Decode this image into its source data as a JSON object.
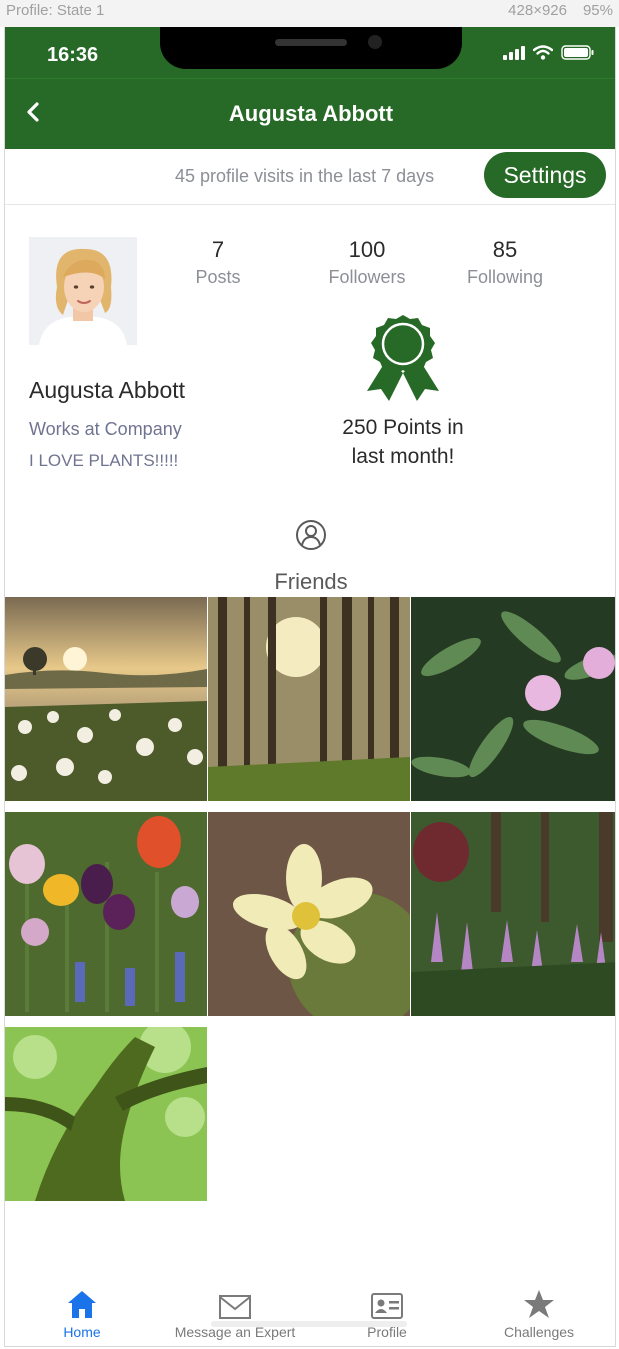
{
  "viewer": {
    "title": "Profile: State 1",
    "dims": "428×926",
    "zoom": "95%"
  },
  "status_bar": {
    "time": "16:36"
  },
  "header": {
    "title": "Augusta Abbott",
    "back_icon": "chevron-left-icon"
  },
  "subbar": {
    "visits": "45 profile visits in the last 7 days",
    "settings_label": "Settings"
  },
  "profile": {
    "name": "Augusta Abbott",
    "work": "Works at Company",
    "bio": "I LOVE PLANTS!!!!!"
  },
  "stats": [
    {
      "value": "7",
      "label": "Posts"
    },
    {
      "value": "100",
      "label": "Followers"
    },
    {
      "value": "85",
      "label": "Following"
    }
  ],
  "award": {
    "icon": "award-ribbon-icon",
    "line1": "250 Points in",
    "line2": "last month!"
  },
  "friends": {
    "label": "Friends",
    "icon": "user-circle-icon"
  },
  "photos": [
    "dandelion-field",
    "sunlit-forest",
    "mimosa-flowers",
    "tulip-garden",
    "lotus-flower",
    "astilbe-garden",
    "mossy-tree"
  ],
  "tabs": [
    {
      "label": "Home",
      "icon": "home-icon",
      "active": true
    },
    {
      "label": "Message an Expert",
      "icon": "mail-icon",
      "active": false
    },
    {
      "label": "Profile",
      "icon": "id-card-icon",
      "active": false
    },
    {
      "label": "Challenges",
      "icon": "star-icon",
      "active": false
    }
  ],
  "colors": {
    "brand_green": "#276a27",
    "active_tab": "#1a73e8",
    "muted_text": "#8c8f96"
  }
}
